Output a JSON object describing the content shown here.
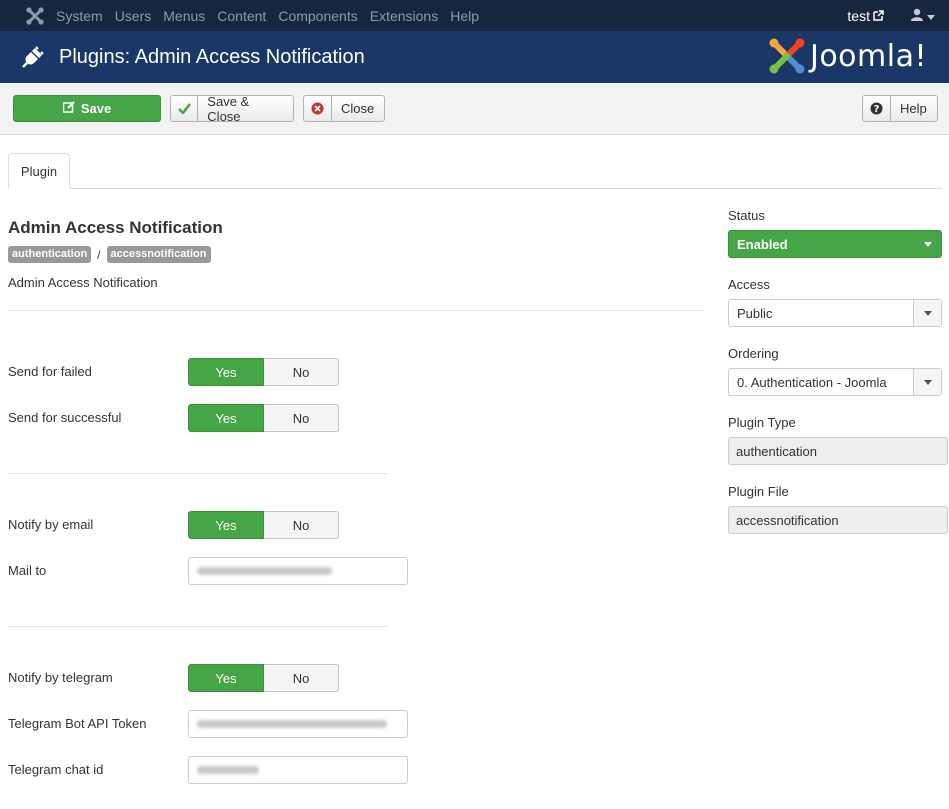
{
  "navbar": {
    "menu": [
      "System",
      "Users",
      "Menus",
      "Content",
      "Components",
      "Extensions",
      "Help"
    ],
    "user": "test"
  },
  "header": {
    "title": "Plugins: Admin Access Notification",
    "brand": "Joomla!"
  },
  "toolbar": {
    "save": "Save",
    "save_close": "Save & Close",
    "close": "Close",
    "help": "Help"
  },
  "tabs": [
    {
      "label": "Plugin",
      "active": true
    }
  ],
  "plugin": {
    "title": "Admin Access Notification",
    "badges": [
      "authentication",
      "accessnotification"
    ],
    "separator": "/",
    "description": "Admin Access Notification"
  },
  "form": {
    "send_failed": {
      "label": "Send for failed",
      "yes": "Yes",
      "no": "No",
      "value": "Yes"
    },
    "send_successful": {
      "label": "Send for successful",
      "yes": "Yes",
      "no": "No",
      "value": "Yes"
    },
    "notify_email": {
      "label": "Notify by email",
      "yes": "Yes",
      "no": "No",
      "value": "Yes"
    },
    "mail_to": {
      "label": "Mail to"
    },
    "notify_telegram": {
      "label": "Notify by telegram",
      "yes": "Yes",
      "no": "No",
      "value": "Yes"
    },
    "telegram_token": {
      "label": "Telegram Bot API Token"
    },
    "telegram_chat": {
      "label": "Telegram chat id"
    }
  },
  "sidebar": {
    "status": {
      "label": "Status",
      "value": "Enabled"
    },
    "access": {
      "label": "Access",
      "value": "Public"
    },
    "ordering": {
      "label": "Ordering",
      "value": "0. Authentication - Joomla"
    },
    "plugin_type": {
      "label": "Plugin Type",
      "value": "authentication"
    },
    "plugin_file": {
      "label": "Plugin File",
      "value": "accessnotification"
    }
  },
  "colors": {
    "navbar": "#17263f",
    "header": "#1a3867",
    "success": "#46a546"
  }
}
